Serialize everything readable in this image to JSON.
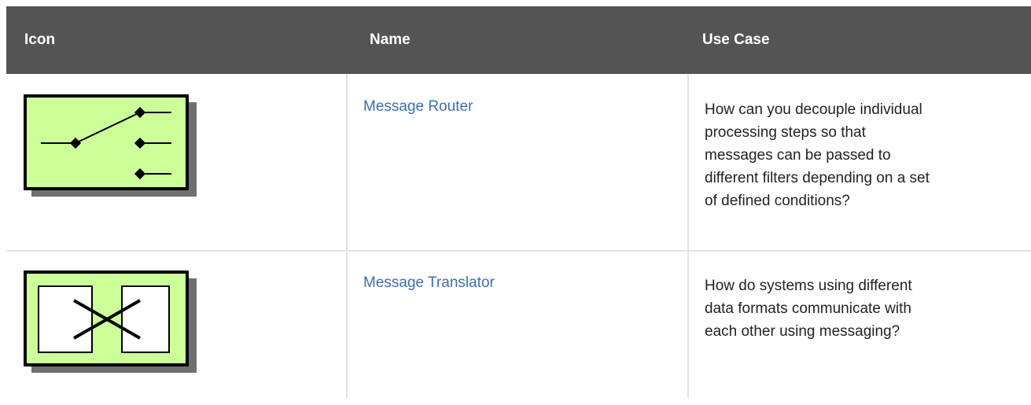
{
  "table": {
    "headers": {
      "icon": "Icon",
      "name": "Name",
      "use_case": "Use Case"
    },
    "rows": [
      {
        "icon": "message-router-icon",
        "name": "Message Router",
        "use_case_lines": [
          "How can you decouple individual",
          "processing steps so that",
          "messages can be passed to",
          "different filters depending on a set",
          "of defined conditions?"
        ]
      },
      {
        "icon": "message-translator-icon",
        "name": "Message Translator",
        "use_case_lines": [
          "How do systems using different",
          "data formats communicate with",
          "each other using messaging?"
        ]
      }
    ]
  },
  "colors": {
    "header_bg": "#545454",
    "icon_fill": "#ccff99",
    "link": "#3c6eb4"
  }
}
